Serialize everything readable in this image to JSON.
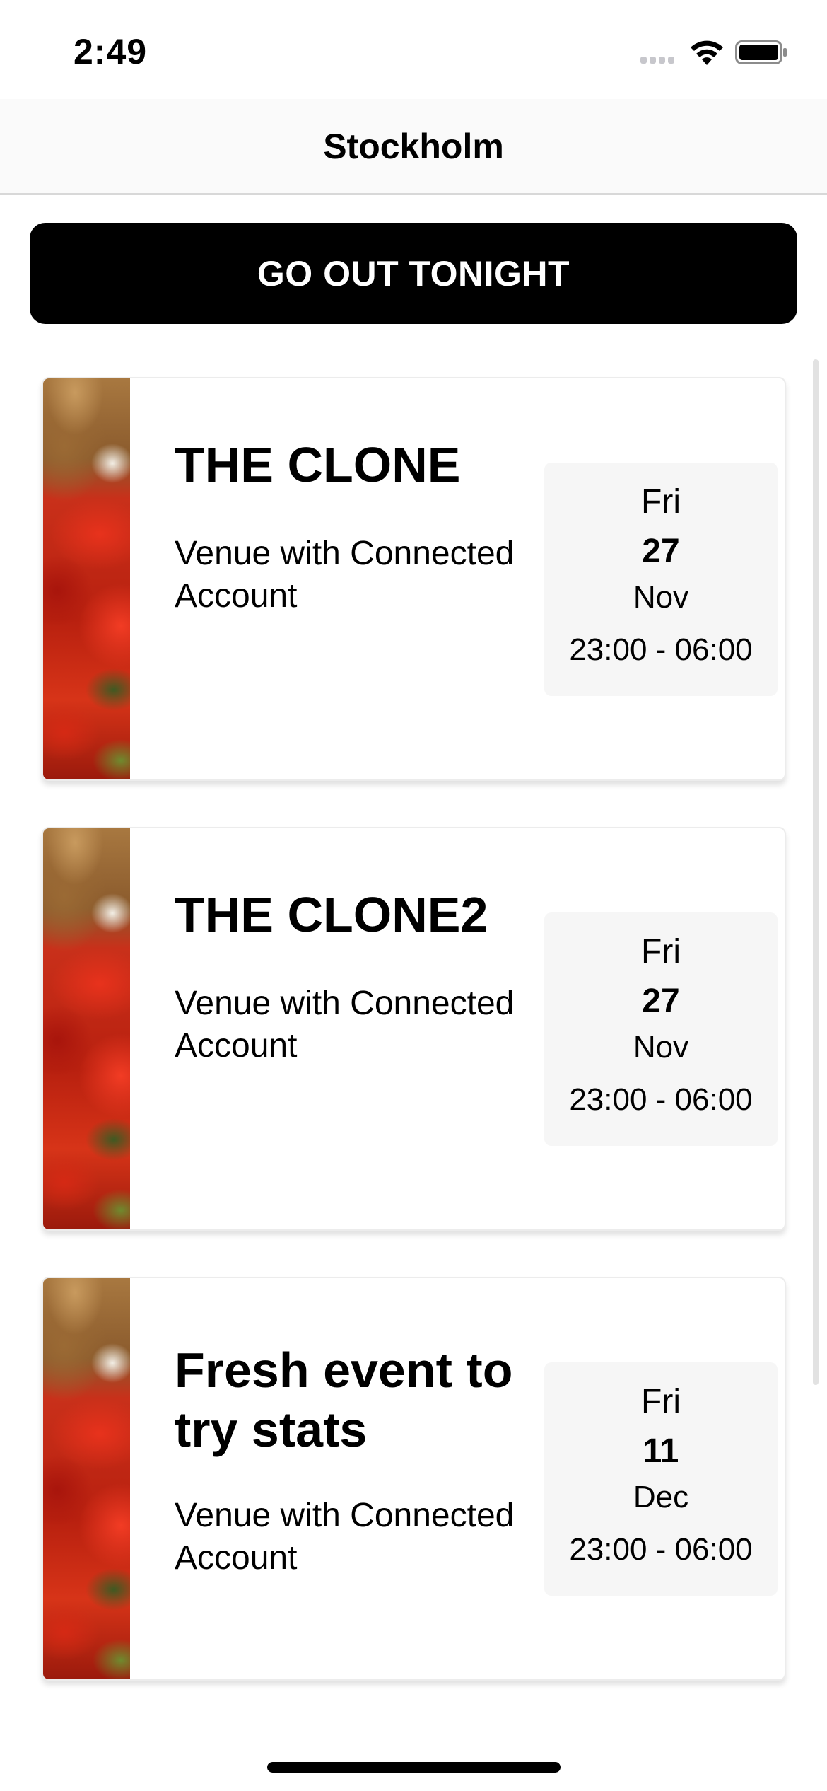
{
  "status_bar": {
    "time": "2:49"
  },
  "nav": {
    "title": "Stockholm"
  },
  "cta": {
    "label": "GO OUT TONIGHT"
  },
  "events": [
    {
      "title": "THE CLONE",
      "venue": "Venue with Connected Account",
      "weekday": "Fri",
      "day": "27",
      "month": "Nov",
      "time": "23:00 - 06:00"
    },
    {
      "title": "THE CLONE2",
      "venue": "Venue with Connected Account",
      "weekday": "Fri",
      "day": "27",
      "month": "Nov",
      "time": "23:00 - 06:00"
    },
    {
      "title": "Fresh event to try stats",
      "venue": "Venue with Connected Account",
      "weekday": "Fri",
      "day": "11",
      "month": "Dec",
      "time": "23:00 - 06:00"
    }
  ]
}
